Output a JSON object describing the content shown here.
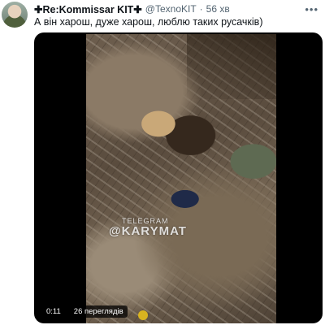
{
  "tweet": {
    "display_name": "✚Re:Kommissar KIT✚",
    "handle": "@TexnoKIT",
    "separator": "·",
    "time": "56 хв",
    "more_icon": "more-horizontal-icon",
    "text": "А він харош, дуже харош, люблю таких русачків)"
  },
  "media": {
    "watermark_top": "TELEGRAM",
    "watermark_main": "@KARYMAT",
    "duration": "0:11",
    "views": "26 переглядів"
  }
}
